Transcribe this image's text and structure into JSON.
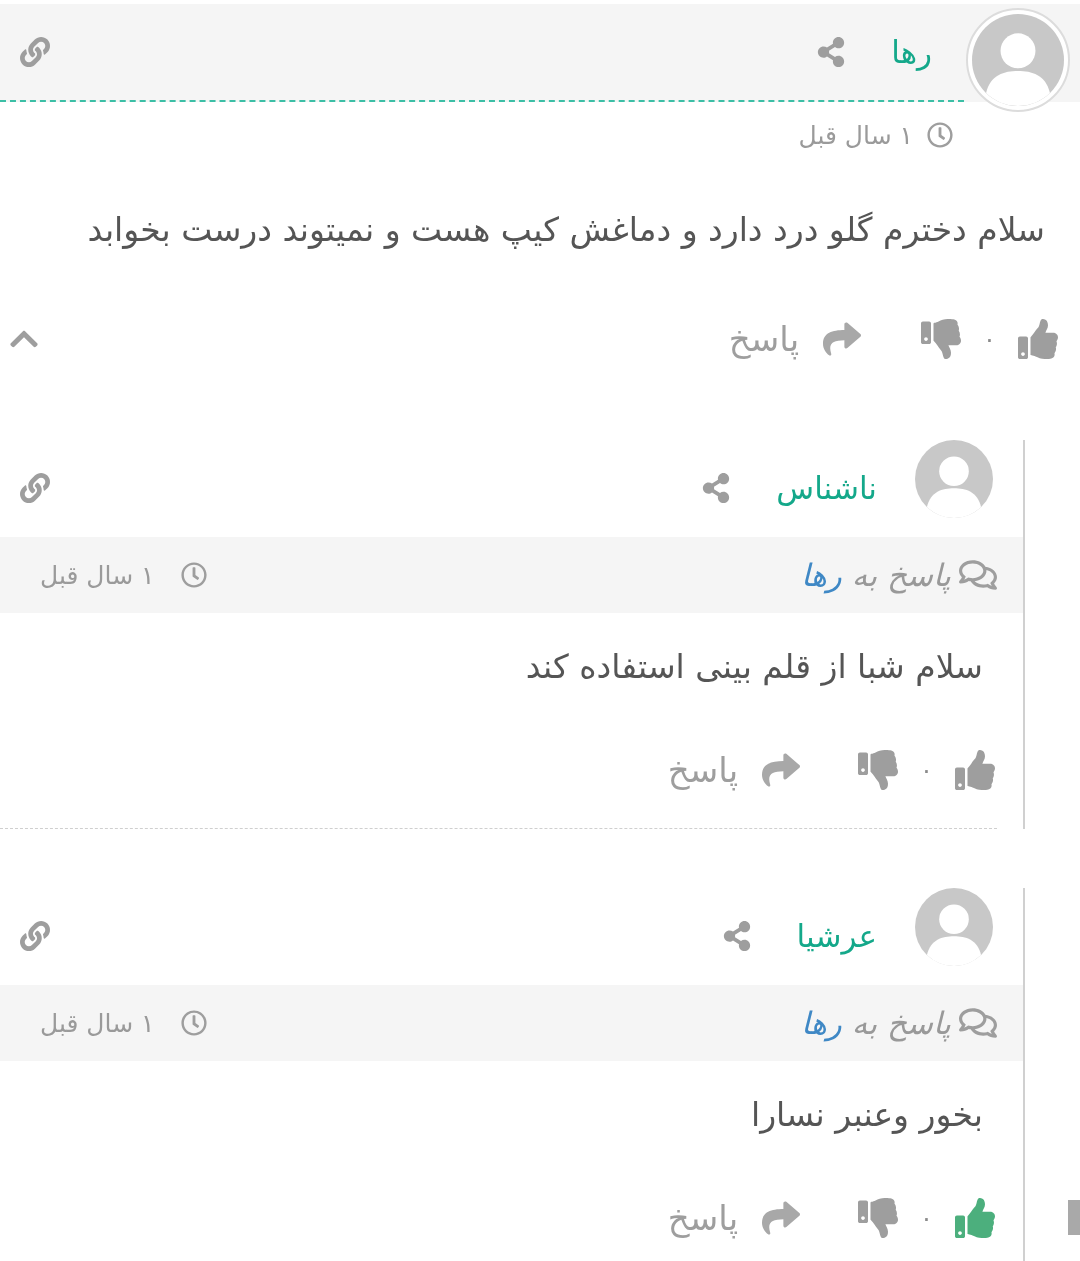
{
  "comment": {
    "author": "رها",
    "time": "۱ سال قبل",
    "text": "سلام دخترم گلو درد دارد و دماغش کیپ هست و نمیتوند درست بخوابد",
    "likes": "۰",
    "liked": false,
    "reply_label": "پاسخ",
    "replies_expanded": true
  },
  "replies": [
    {
      "author": "ناشناس",
      "reply_to_prefix": "پاسخ به",
      "reply_to": "رها",
      "time": "۱ سال قبل",
      "text": "سلام شبا از قلم بینی استفاده کند",
      "likes": "۰",
      "liked": false,
      "reply_label": "پاسخ"
    },
    {
      "author": "عرشیا",
      "reply_to_prefix": "پاسخ به",
      "reply_to": "رها",
      "time": "۱ سال قبل",
      "text": "بخور وعنبر نسارا",
      "likes": "۰",
      "liked": true,
      "reply_label": "پاسخ"
    }
  ]
}
